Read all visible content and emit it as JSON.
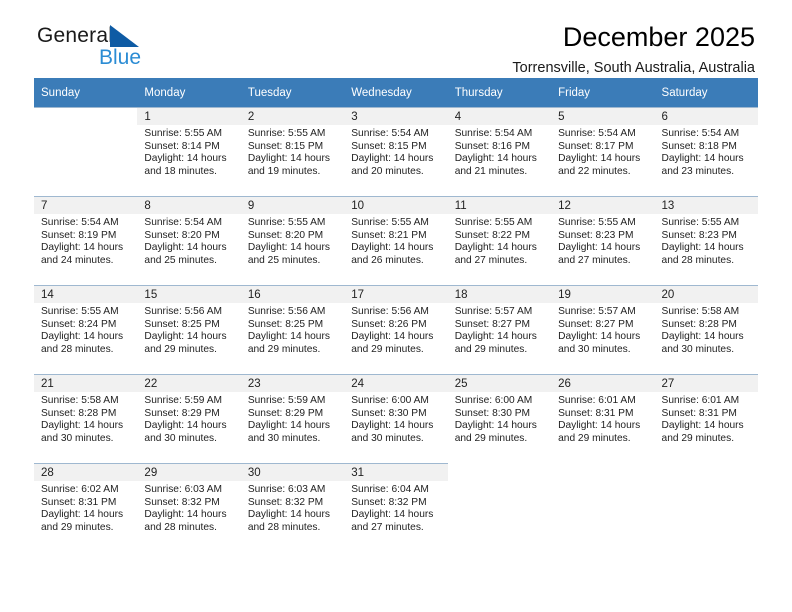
{
  "brand": {
    "name_part1": "General",
    "name_part2": "Blue",
    "logo_icon": "triangle-flag-icon",
    "accent_color": "#2b8cd4",
    "dark_accent_color": "#0e5ba4"
  },
  "header": {
    "title": "December 2025",
    "subtitle": "Torrensville, South Australia, Australia"
  },
  "calendar": {
    "header_bg_color": "#3b7cb8",
    "grid_line_color": "#9fb8d0",
    "daynum_bg_color": "#f1f1f1",
    "weekday_headers": [
      "Sunday",
      "Monday",
      "Tuesday",
      "Wednesday",
      "Thursday",
      "Friday",
      "Saturday"
    ],
    "weeks": [
      [
        {
          "day": "",
          "sunrise": "",
          "sunset": "",
          "daylight": "",
          "empty": true
        },
        {
          "day": "1",
          "sunrise": "Sunrise: 5:55 AM",
          "sunset": "Sunset: 8:14 PM",
          "daylight": "Daylight: 14 hours and 18 minutes."
        },
        {
          "day": "2",
          "sunrise": "Sunrise: 5:55 AM",
          "sunset": "Sunset: 8:15 PM",
          "daylight": "Daylight: 14 hours and 19 minutes."
        },
        {
          "day": "3",
          "sunrise": "Sunrise: 5:54 AM",
          "sunset": "Sunset: 8:15 PM",
          "daylight": "Daylight: 14 hours and 20 minutes."
        },
        {
          "day": "4",
          "sunrise": "Sunrise: 5:54 AM",
          "sunset": "Sunset: 8:16 PM",
          "daylight": "Daylight: 14 hours and 21 minutes."
        },
        {
          "day": "5",
          "sunrise": "Sunrise: 5:54 AM",
          "sunset": "Sunset: 8:17 PM",
          "daylight": "Daylight: 14 hours and 22 minutes."
        },
        {
          "day": "6",
          "sunrise": "Sunrise: 5:54 AM",
          "sunset": "Sunset: 8:18 PM",
          "daylight": "Daylight: 14 hours and 23 minutes."
        }
      ],
      [
        {
          "day": "7",
          "sunrise": "Sunrise: 5:54 AM",
          "sunset": "Sunset: 8:19 PM",
          "daylight": "Daylight: 14 hours and 24 minutes."
        },
        {
          "day": "8",
          "sunrise": "Sunrise: 5:54 AM",
          "sunset": "Sunset: 8:20 PM",
          "daylight": "Daylight: 14 hours and 25 minutes."
        },
        {
          "day": "9",
          "sunrise": "Sunrise: 5:55 AM",
          "sunset": "Sunset: 8:20 PM",
          "daylight": "Daylight: 14 hours and 25 minutes."
        },
        {
          "day": "10",
          "sunrise": "Sunrise: 5:55 AM",
          "sunset": "Sunset: 8:21 PM",
          "daylight": "Daylight: 14 hours and 26 minutes."
        },
        {
          "day": "11",
          "sunrise": "Sunrise: 5:55 AM",
          "sunset": "Sunset: 8:22 PM",
          "daylight": "Daylight: 14 hours and 27 minutes."
        },
        {
          "day": "12",
          "sunrise": "Sunrise: 5:55 AM",
          "sunset": "Sunset: 8:23 PM",
          "daylight": "Daylight: 14 hours and 27 minutes."
        },
        {
          "day": "13",
          "sunrise": "Sunrise: 5:55 AM",
          "sunset": "Sunset: 8:23 PM",
          "daylight": "Daylight: 14 hours and 28 minutes."
        }
      ],
      [
        {
          "day": "14",
          "sunrise": "Sunrise: 5:55 AM",
          "sunset": "Sunset: 8:24 PM",
          "daylight": "Daylight: 14 hours and 28 minutes."
        },
        {
          "day": "15",
          "sunrise": "Sunrise: 5:56 AM",
          "sunset": "Sunset: 8:25 PM",
          "daylight": "Daylight: 14 hours and 29 minutes."
        },
        {
          "day": "16",
          "sunrise": "Sunrise: 5:56 AM",
          "sunset": "Sunset: 8:25 PM",
          "daylight": "Daylight: 14 hours and 29 minutes."
        },
        {
          "day": "17",
          "sunrise": "Sunrise: 5:56 AM",
          "sunset": "Sunset: 8:26 PM",
          "daylight": "Daylight: 14 hours and 29 minutes."
        },
        {
          "day": "18",
          "sunrise": "Sunrise: 5:57 AM",
          "sunset": "Sunset: 8:27 PM",
          "daylight": "Daylight: 14 hours and 29 minutes."
        },
        {
          "day": "19",
          "sunrise": "Sunrise: 5:57 AM",
          "sunset": "Sunset: 8:27 PM",
          "daylight": "Daylight: 14 hours and 30 minutes."
        },
        {
          "day": "20",
          "sunrise": "Sunrise: 5:58 AM",
          "sunset": "Sunset: 8:28 PM",
          "daylight": "Daylight: 14 hours and 30 minutes."
        }
      ],
      [
        {
          "day": "21",
          "sunrise": "Sunrise: 5:58 AM",
          "sunset": "Sunset: 8:28 PM",
          "daylight": "Daylight: 14 hours and 30 minutes."
        },
        {
          "day": "22",
          "sunrise": "Sunrise: 5:59 AM",
          "sunset": "Sunset: 8:29 PM",
          "daylight": "Daylight: 14 hours and 30 minutes."
        },
        {
          "day": "23",
          "sunrise": "Sunrise: 5:59 AM",
          "sunset": "Sunset: 8:29 PM",
          "daylight": "Daylight: 14 hours and 30 minutes."
        },
        {
          "day": "24",
          "sunrise": "Sunrise: 6:00 AM",
          "sunset": "Sunset: 8:30 PM",
          "daylight": "Daylight: 14 hours and 30 minutes."
        },
        {
          "day": "25",
          "sunrise": "Sunrise: 6:00 AM",
          "sunset": "Sunset: 8:30 PM",
          "daylight": "Daylight: 14 hours and 29 minutes."
        },
        {
          "day": "26",
          "sunrise": "Sunrise: 6:01 AM",
          "sunset": "Sunset: 8:31 PM",
          "daylight": "Daylight: 14 hours and 29 minutes."
        },
        {
          "day": "27",
          "sunrise": "Sunrise: 6:01 AM",
          "sunset": "Sunset: 8:31 PM",
          "daylight": "Daylight: 14 hours and 29 minutes."
        }
      ],
      [
        {
          "day": "28",
          "sunrise": "Sunrise: 6:02 AM",
          "sunset": "Sunset: 8:31 PM",
          "daylight": "Daylight: 14 hours and 29 minutes."
        },
        {
          "day": "29",
          "sunrise": "Sunrise: 6:03 AM",
          "sunset": "Sunset: 8:32 PM",
          "daylight": "Daylight: 14 hours and 28 minutes."
        },
        {
          "day": "30",
          "sunrise": "Sunrise: 6:03 AM",
          "sunset": "Sunset: 8:32 PM",
          "daylight": "Daylight: 14 hours and 28 minutes."
        },
        {
          "day": "31",
          "sunrise": "Sunrise: 6:04 AM",
          "sunset": "Sunset: 8:32 PM",
          "daylight": "Daylight: 14 hours and 27 minutes."
        },
        {
          "day": "",
          "sunrise": "",
          "sunset": "",
          "daylight": "",
          "empty": true,
          "nodata": true
        },
        {
          "day": "",
          "sunrise": "",
          "sunset": "",
          "daylight": "",
          "empty": true,
          "nodata": true
        },
        {
          "day": "",
          "sunrise": "",
          "sunset": "",
          "daylight": "",
          "empty": true,
          "nodata": true
        }
      ]
    ]
  }
}
